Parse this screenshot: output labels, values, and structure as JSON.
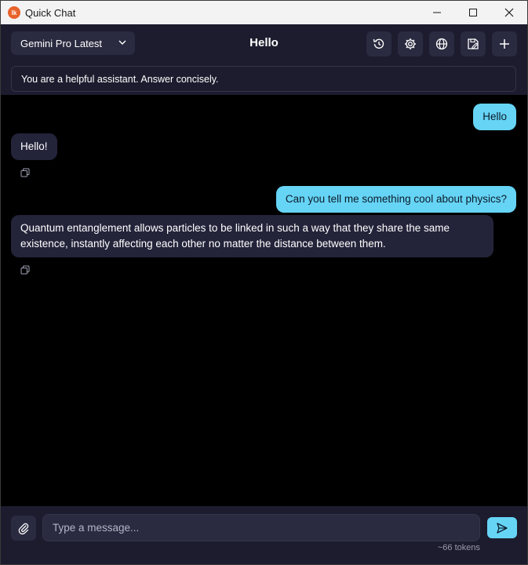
{
  "window": {
    "title": "Quick Chat",
    "app_icon_text": "lk"
  },
  "header": {
    "model": "Gemini Pro Latest",
    "chat_title": "Hello",
    "tools": [
      "history-icon",
      "gear-icon",
      "globe-icon",
      "save-notes-icon",
      "plus-icon"
    ]
  },
  "system_prompt": "You are a helpful assistant. Answer concisely.",
  "messages": [
    {
      "role": "user",
      "text": "Hello"
    },
    {
      "role": "assistant",
      "text": "Hello!"
    },
    {
      "role": "user",
      "text": "Can you tell me something cool about physics?"
    },
    {
      "role": "assistant",
      "text": "Quantum entanglement allows particles to be linked in such a way that they share the same existence, instantly affecting each other no matter the distance between them."
    }
  ],
  "composer": {
    "placeholder": "Type a message...",
    "value": "",
    "token_count": "~66 tokens"
  },
  "colors": {
    "user_bubble": "#66d4f5",
    "assistant_bubble": "#23233a",
    "panel": "#1c1c2e",
    "background": "#000000"
  }
}
